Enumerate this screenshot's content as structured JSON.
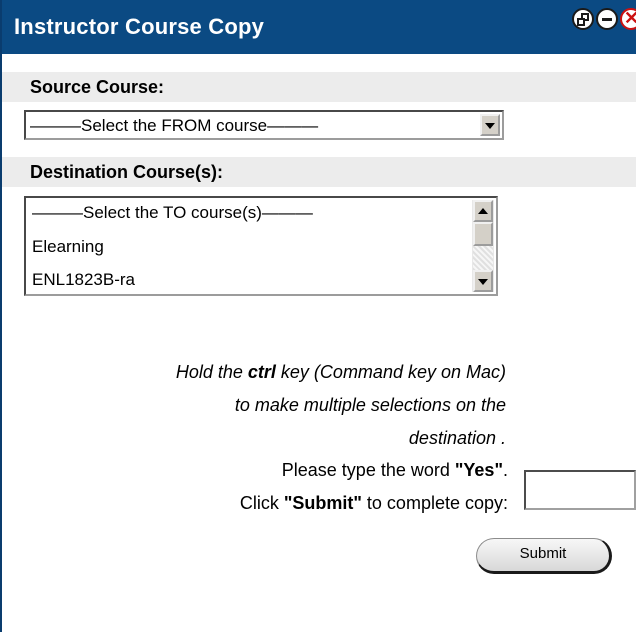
{
  "window": {
    "title": "Instructor Course Copy",
    "controls": {
      "restore_icon": "restore-icon",
      "minimize_icon": "minimize-icon",
      "close_icon": "close-icon",
      "close_glyph": "✕"
    }
  },
  "source": {
    "label": "Source Course:",
    "selected": "———Select the FROM course———"
  },
  "destination": {
    "label": "Destination Course(s):",
    "options": [
      "———Select the TO course(s)———",
      "Elearning",
      "ENL1823B-ra"
    ]
  },
  "help": {
    "line1": {
      "pre": "Hold the ",
      "bold": "ctrl",
      "post": " key (Command key on Mac)"
    },
    "line2": "to make multiple selections on the",
    "line3": "destination ."
  },
  "confirm": {
    "line1": {
      "pre": "Please type the word ",
      "bold": "\"Yes\"",
      "post": "."
    },
    "line2": {
      "pre": "Click ",
      "bold": "\"Submit\"",
      "post": " to complete copy:"
    },
    "input_value": ""
  },
  "submit_label": "Submit",
  "colors": {
    "titlebar": "#0b4a83",
    "section_bg": "#ececec"
  }
}
